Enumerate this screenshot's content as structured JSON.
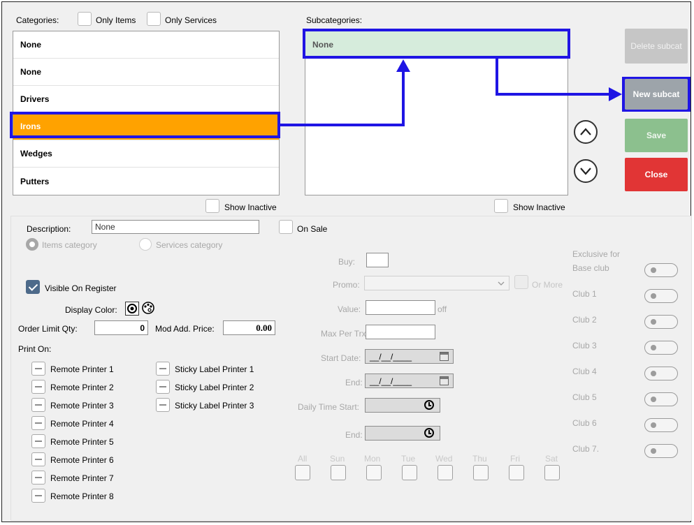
{
  "categories": {
    "label": "Categories:",
    "only_items": "Only Items",
    "only_services": "Only Services",
    "items": [
      {
        "label": "None"
      },
      {
        "label": "None"
      },
      {
        "label": "Drivers"
      },
      {
        "label": "Irons",
        "selected": true
      },
      {
        "label": "Wedges"
      },
      {
        "label": "Putters"
      }
    ],
    "show_inactive": "Show Inactive"
  },
  "subcategories": {
    "label": "Subcategories:",
    "items": [
      {
        "label": "None",
        "selected": true
      }
    ],
    "show_inactive": "Show Inactive"
  },
  "buttons": {
    "delete_subcat": "Delete subcat",
    "new_subcat": "New subcat",
    "save": "Save",
    "close": "Close"
  },
  "details": {
    "description_label": "Description:",
    "description_value": "None",
    "on_sale": "On Sale",
    "items_category": "Items category",
    "services_category": "Services category",
    "visible_on_register": "Visible On Register",
    "display_color": "Display Color:",
    "order_limit_label": "Order Limit Qty:",
    "order_limit_value": "0",
    "mod_add_price_label": "Mod Add. Price:",
    "mod_add_price_value": "0.00",
    "print_on": "Print On:",
    "remote_printers": [
      "Remote Printer 1",
      "Remote Printer 2",
      "Remote Printer 3",
      "Remote Printer 4",
      "Remote Printer 5",
      "Remote Printer 6",
      "Remote Printer 7",
      "Remote Printer 8"
    ],
    "sticky_printers": [
      "Sticky Label Printer 1",
      "Sticky Label Printer 2",
      "Sticky Label Printer 3"
    ]
  },
  "promo": {
    "buy": "Buy:",
    "promo": "Promo:",
    "or_more": "Or More",
    "value": "Value:",
    "off": "off",
    "max_per_trx": "Max Per Trx:",
    "start_date": "Start Date:",
    "start_date_value": "__/__/____",
    "end": "End:",
    "end_date_value": "__/__/____",
    "daily_time_start": "Daily Time Start:",
    "time_end": "End:",
    "days": [
      "All",
      "Sun",
      "Mon",
      "Tue",
      "Wed",
      "Thu",
      "Fri",
      "Sat"
    ]
  },
  "clubs": {
    "exclusive_for": "Exclusive for",
    "base_club": "Base club",
    "list": [
      "Club 1",
      "Club 2",
      "Club 3",
      "Club 4",
      "Club 5",
      "Club 6",
      "Club 7."
    ]
  },
  "colors": {
    "selected_category": "#ffa200",
    "selected_subcategory": "#d6ecdc",
    "highlight": "#1f15e4",
    "save": "#8cc08e",
    "close": "#e13535",
    "new_subcat": "#9da4aa",
    "delete_subcat": "#c6c6c6"
  }
}
